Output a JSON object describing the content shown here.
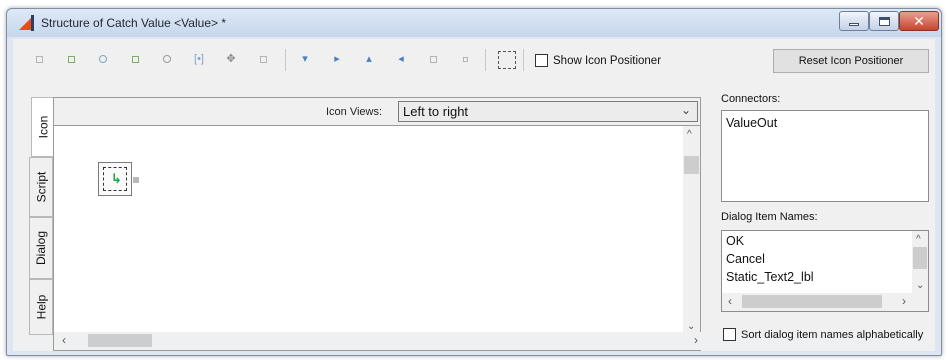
{
  "window": {
    "title": "Structure of Catch Value <Value> *"
  },
  "toolbar": {
    "icons": [
      "align-left-icon",
      "align-top-icon",
      "circle-icon",
      "square-icon",
      "target-icon",
      "bracket-icon",
      "move-icon",
      "grid-icon",
      "terminal-bottom-icon",
      "terminal-right-icon",
      "terminal-top-icon",
      "terminal-left-icon",
      "terminal-bottom-alt-icon",
      "small-square-icon",
      "dashed-selection-icon"
    ],
    "show_icon_positioner_label": "Show Icon Positioner",
    "reset_icon_positioner_label": "Reset Icon Positioner"
  },
  "tabs": [
    {
      "label": "Icon",
      "active": true
    },
    {
      "label": "Script",
      "active": false
    },
    {
      "label": "Dialog",
      "active": false
    },
    {
      "label": "Help",
      "active": false
    }
  ],
  "icon_views": {
    "label": "Icon Views:",
    "value": "Left to right"
  },
  "connectors": {
    "label": "Connectors:",
    "items": [
      "ValueOut"
    ]
  },
  "dialog_items": {
    "label": "Dialog Item Names:",
    "items": [
      "OK",
      "Cancel",
      "Static_Text2_lbl"
    ]
  },
  "sort_checkbox_label": "Sort dialog item names alphabetically",
  "colors": {
    "accent_green": "#7cb06a",
    "close_red": "#c7452f",
    "titlebar": "#c6d6ec"
  }
}
